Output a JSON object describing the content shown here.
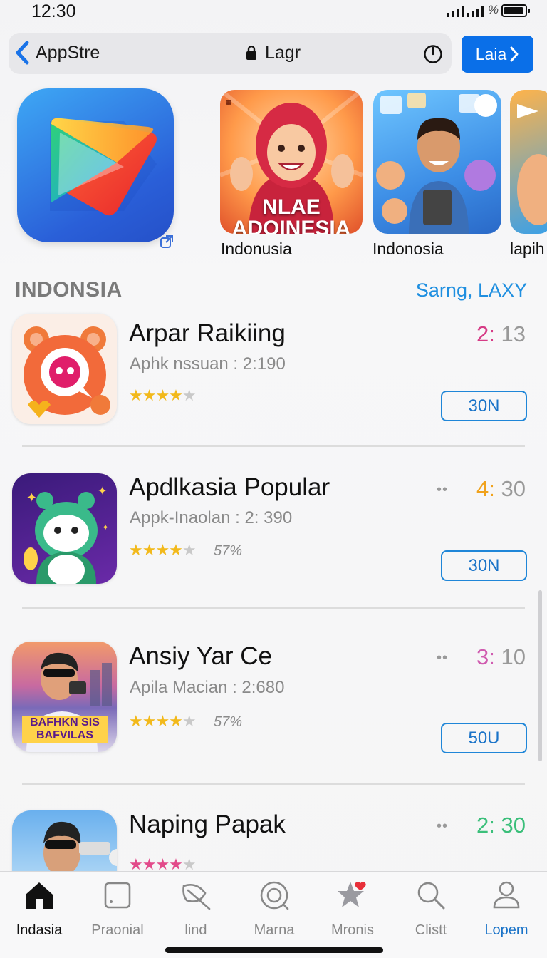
{
  "status_bar": {
    "time": "12:30",
    "percent_glyph": "%"
  },
  "url_bar": {
    "site": "AppStre",
    "query": "Lagr"
  },
  "header_button": {
    "label": "Laia"
  },
  "featured": {
    "cards": [
      {
        "label": "Indonusia",
        "overlay": [
          "NLAE",
          "ADOINESIA"
        ]
      },
      {
        "label": "Indonosia"
      },
      {
        "label": "lapih"
      }
    ]
  },
  "section": {
    "title": "INDONSIA",
    "link": "Sarng, LAXY"
  },
  "apps": [
    {
      "title": "Arpar Raikiing",
      "subtitle": "Aphk nssuan : 2:190",
      "rating": 4.5,
      "rating_pct": "",
      "time_hour": "2:",
      "time_min": " 13",
      "time_color": "#d63c86",
      "get_label": "30N",
      "badge_text": ""
    },
    {
      "title": "Apdlkasia Popular",
      "subtitle": "Appk-Inaolan : 2: 390",
      "rating": 4.5,
      "rating_pct": "57%",
      "time_hour": "4:",
      "time_min": " 30",
      "time_color": "#f0a21c",
      "get_label": "30N",
      "badge_text": ""
    },
    {
      "title": "Ansiy Yar Ce",
      "subtitle": "Apila Macian : 2:680",
      "rating": 4.5,
      "rating_pct": "57%",
      "time_hour": "3:",
      "time_min": " 10",
      "time_color": "#d05cb0",
      "get_label": "50U",
      "badge_text": "BAFHKN SIS BAFVILAS"
    },
    {
      "title": "Naping Papak",
      "subtitle": "",
      "rating": 4.5,
      "rating_pct": "",
      "time_hour": "2:",
      "time_min": " 30",
      "time_color": "#3bbf7a",
      "get_label": "",
      "badge_text": ""
    }
  ],
  "tab_bar": {
    "tabs": [
      {
        "label": "Indasia",
        "icon": "home-icon",
        "active": true
      },
      {
        "label": "Praonial",
        "icon": "square-icon"
      },
      {
        "label": "lind",
        "icon": "leaf-icon"
      },
      {
        "label": "Marna",
        "icon": "at-icon"
      },
      {
        "label": "Mronis",
        "icon": "star-heart-icon"
      },
      {
        "label": "Clistt",
        "icon": "search-icon"
      },
      {
        "label": "Lopem",
        "icon": "person-icon"
      }
    ]
  }
}
